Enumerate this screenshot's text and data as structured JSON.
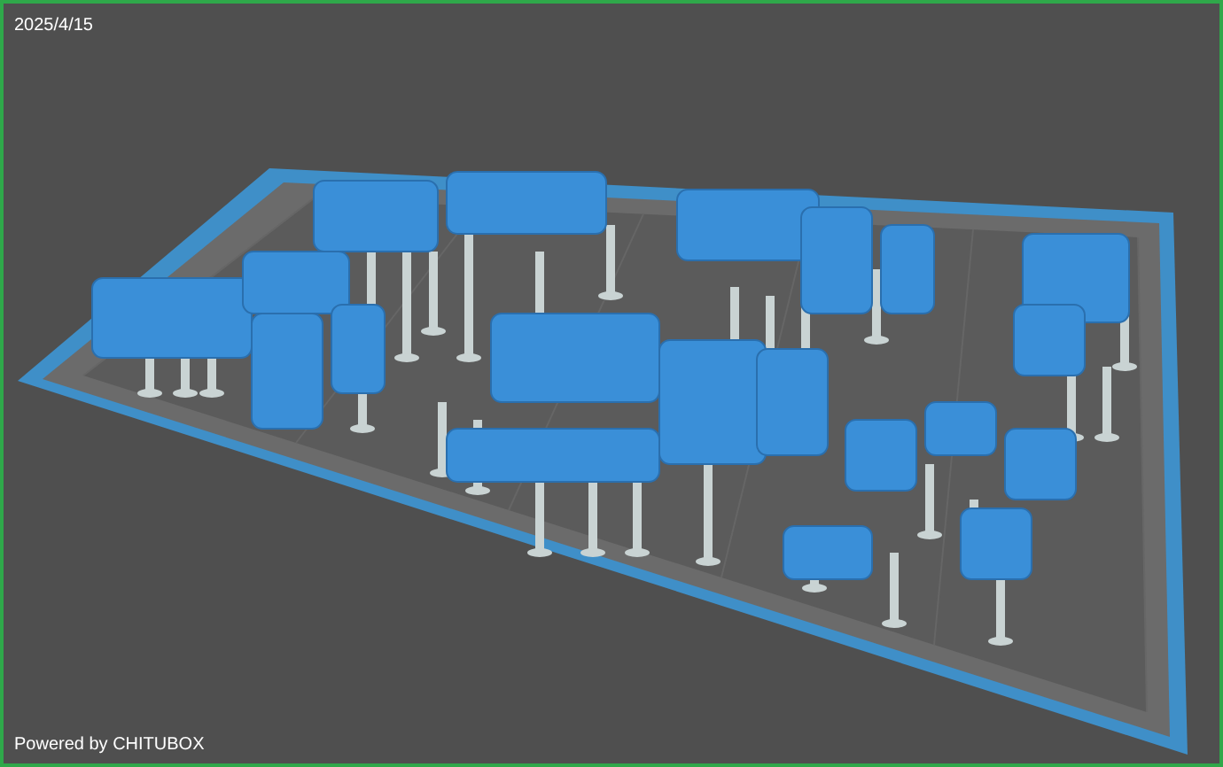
{
  "viewport": {
    "date": "2025/4/15",
    "footer_text": "Powered by CHITUBOX"
  }
}
